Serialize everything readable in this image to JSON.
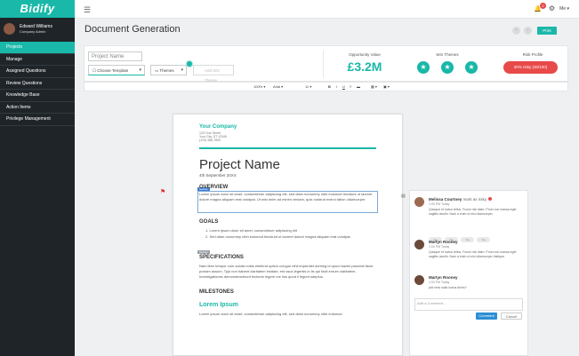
{
  "brand": "Bidify",
  "user": {
    "name": "Edward Williams",
    "role": "Company Admin"
  },
  "nav": [
    "Projects",
    "Manage",
    "Assigned Questions",
    "Review Questions",
    "Knowledge Base",
    "Action Items",
    "Privilege Management"
  ],
  "topbar": {
    "notif_count": "2",
    "me_label": "Me"
  },
  "page_title": "Document Generation",
  "print_label": "Print",
  "project_name_placeholder": "Project Name",
  "choose_template": "Choose Template",
  "themes_label": "Themes",
  "add_win_theme": "Add Win Theme",
  "opportunity": {
    "label": "Opportunity Value",
    "value": "£3.2M"
  },
  "win_themes_label": "Win Themes",
  "risk": {
    "label": "Risk Profile",
    "pill": "30% risky (30/100)"
  },
  "toolbar": {
    "zoom": "100%",
    "font": "Arial",
    "size": "11",
    "bold": "B",
    "italic": "I",
    "underline": "U"
  },
  "doc": {
    "company": "Your Company",
    "addr": [
      "123 Your Street",
      "Your City, ST 12345",
      "(123) 456-7890"
    ],
    "title": "Project Name",
    "date": "4th September 20XX",
    "overview_h": "OVERVIEW",
    "overview_txt": "Lorem ipsum dolor sit amet, consectetuer adipiscing elit, sed diam nonummy nibh euismod tincidunt ut laoreet dolore magna aliquam erat volutpat. Ut wisi enim ad minim veniam, quis nostrud exerci tation ullamcorper.",
    "goals_h": "GOALS",
    "goal1": "1.  Lorem ipsum dolor sit amet, consectetuer adipiscing elit",
    "goal2": "2.  Sed diam nonummy nibh euismod tincidunt ut laoreet dolore magna aliquam erat volutpat.",
    "spec_h": "SPECIFICATIONS",
    "spec_txt": "Nam liber tempor cum soluta nobis eleifend option congue nihil imperdiet doming id quod mazim placerat facer possim assum. Typi non habent claritatem insitam; est usus legentis in iis qui facit eorum claritatem. Investigationes demonstraverunt lectores legere me lius quod ii legunt saepius.",
    "milestones_h": "MILESTONES",
    "lorem_green": "Lorem Ipsum",
    "lorem_tail": "Lorem ipsum dolor sit amet, consectetuer adipiscing elit, sed diam nonummy nibh euismod",
    "tag_blue": "Section",
    "tag_gray": "Section"
  },
  "comments": [
    {
      "name": "Melissa Courtney",
      "mark": "marit as risky",
      "time": "1:00 PM Today",
      "text": "Quisque et luctus tellus. Fusce nisi diam. Proin non massa eget sagittis iaculis. Nam a enim ut nisi ullamcorper.",
      "btns": [
        "Tag",
        "Tag",
        "Tag",
        "Tag"
      ]
    },
    {
      "name": "Martyn Rooney",
      "mark": "",
      "time": "1:00 PM Today",
      "text": "Quisque et luctus tellus. Fusce nisi diam. Proin non massa eget sagittis iaculis. Nam a enim ut nisi ullamcorper tristique."
    },
    {
      "name": "Martyn Rooney",
      "mark": "",
      "time": "1:00 PM Today",
      "text": "pici nela nulla luctus dictro?"
    }
  ],
  "add_comment_placeholder": "Add a Comment...",
  "submit_label": "Comment",
  "cancel_label": "Cancel"
}
